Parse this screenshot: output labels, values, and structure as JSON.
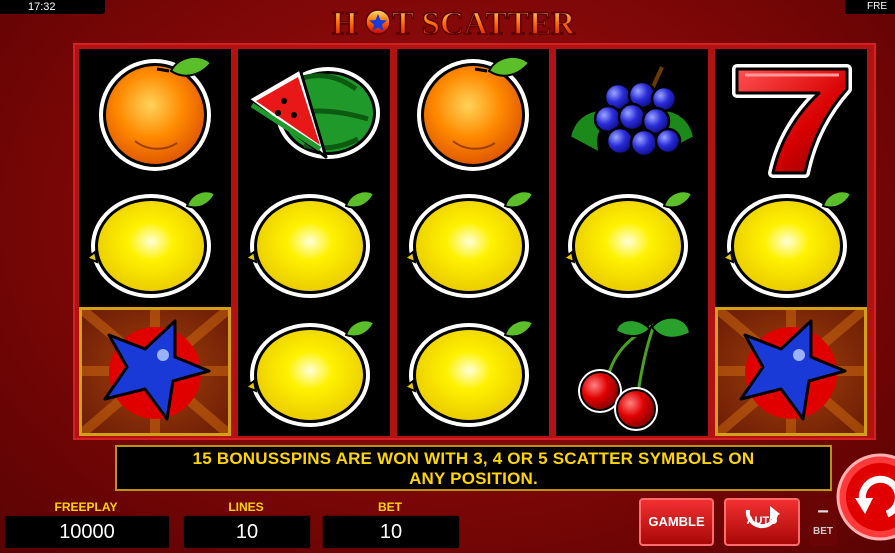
{
  "status_bar": {
    "time": "17:32",
    "right_text": "FRE"
  },
  "title": {
    "part1": "H",
    "part2": "T SCATTER"
  },
  "reels": [
    [
      "orange",
      "lemon",
      "star"
    ],
    [
      "watermelon",
      "lemon",
      "lemon"
    ],
    [
      "orange",
      "lemon",
      "lemon"
    ],
    [
      "grapes",
      "lemon",
      "cherries"
    ],
    [
      "seven",
      "lemon",
      "star"
    ]
  ],
  "highlighted_symbol": "star",
  "message": {
    "line1": "15 BONUSSPINS ARE WON WITH 3, 4 OR 5 SCATTER SYMBOLS ON",
    "line2": "ANY POSITION."
  },
  "freeplay": {
    "label": "FREEPLAY",
    "value": "10000"
  },
  "lines": {
    "label": "LINES",
    "value": "10"
  },
  "bet": {
    "label": "BET",
    "value": "10"
  },
  "buttons": {
    "gamble": "GAMBLE",
    "auto": "AUTO",
    "bet_minus": "−",
    "bet_label": "BET"
  },
  "colors": {
    "label_yellow": "#ffd400",
    "frame_red": "#b31212",
    "reel_black": "#000000"
  }
}
